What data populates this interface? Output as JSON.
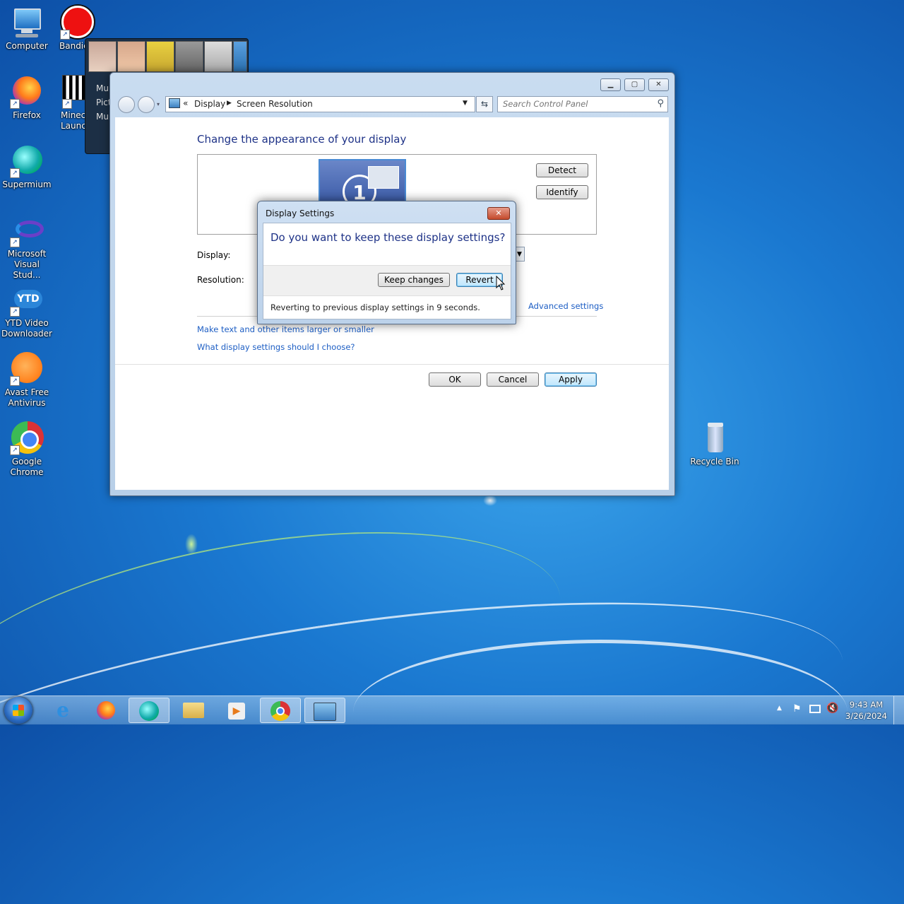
{
  "desktop": {
    "icons": [
      {
        "label": "Computer"
      },
      {
        "label": "Bandic"
      },
      {
        "label": "Firefox"
      },
      {
        "label": "Minec Launc"
      },
      {
        "label": "Supermium"
      },
      {
        "label": "Microsoft Visual Stud..."
      },
      {
        "label": "YTD Video Downloader"
      },
      {
        "label": "Avast Free Antivirus"
      },
      {
        "label": "Google Chrome"
      },
      {
        "label": "Recycle Bin"
      }
    ],
    "gallery_partial_text": [
      "Mu",
      "Pict",
      "Mu"
    ]
  },
  "window": {
    "breadcrumb_chevron": "«",
    "breadcrumb": [
      "Display",
      "Screen Resolution"
    ],
    "search_placeholder": "Search Control Panel",
    "heading": "Change the appearance of your display",
    "monitor_number": "1",
    "detect_label": "Detect",
    "identify_label": "Identify",
    "display_label": "Display:",
    "resolution_label": "Resolution:",
    "advanced_link": "Advanced settings",
    "link_text_size": "Make text and other items larger or smaller",
    "link_choose": "What display settings should I choose?",
    "ok_label": "OK",
    "cancel_label": "Cancel",
    "apply_label": "Apply"
  },
  "dialog": {
    "title": "Display Settings",
    "question": "Do you want to keep these display settings?",
    "keep_label": "Keep changes",
    "revert_label": "Revert",
    "countdown": "Reverting to previous display settings in 9 seconds."
  },
  "taskbar": {
    "time": "9:43 AM",
    "date": "3/26/2024"
  }
}
